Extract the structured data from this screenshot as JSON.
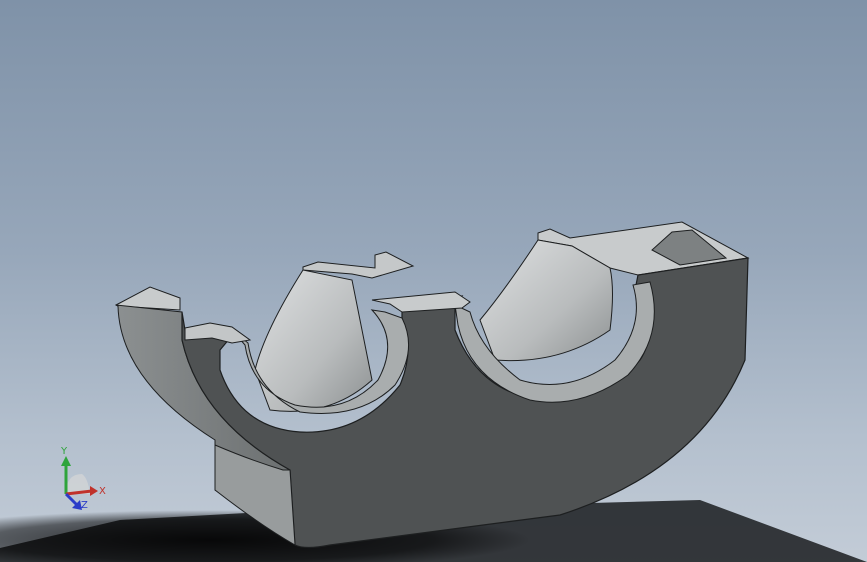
{
  "viewport": {
    "background_top": "#7f92a8",
    "background_bottom": "#c3ccd7",
    "model_color": "#4f5253",
    "model_highlight": "#c2c5c6"
  },
  "triad": {
    "x_label": "X",
    "y_label": "Y",
    "z_label": "Z",
    "x_color": "#c0322b",
    "y_color": "#2ea43b",
    "z_color": "#2b3cc8"
  }
}
